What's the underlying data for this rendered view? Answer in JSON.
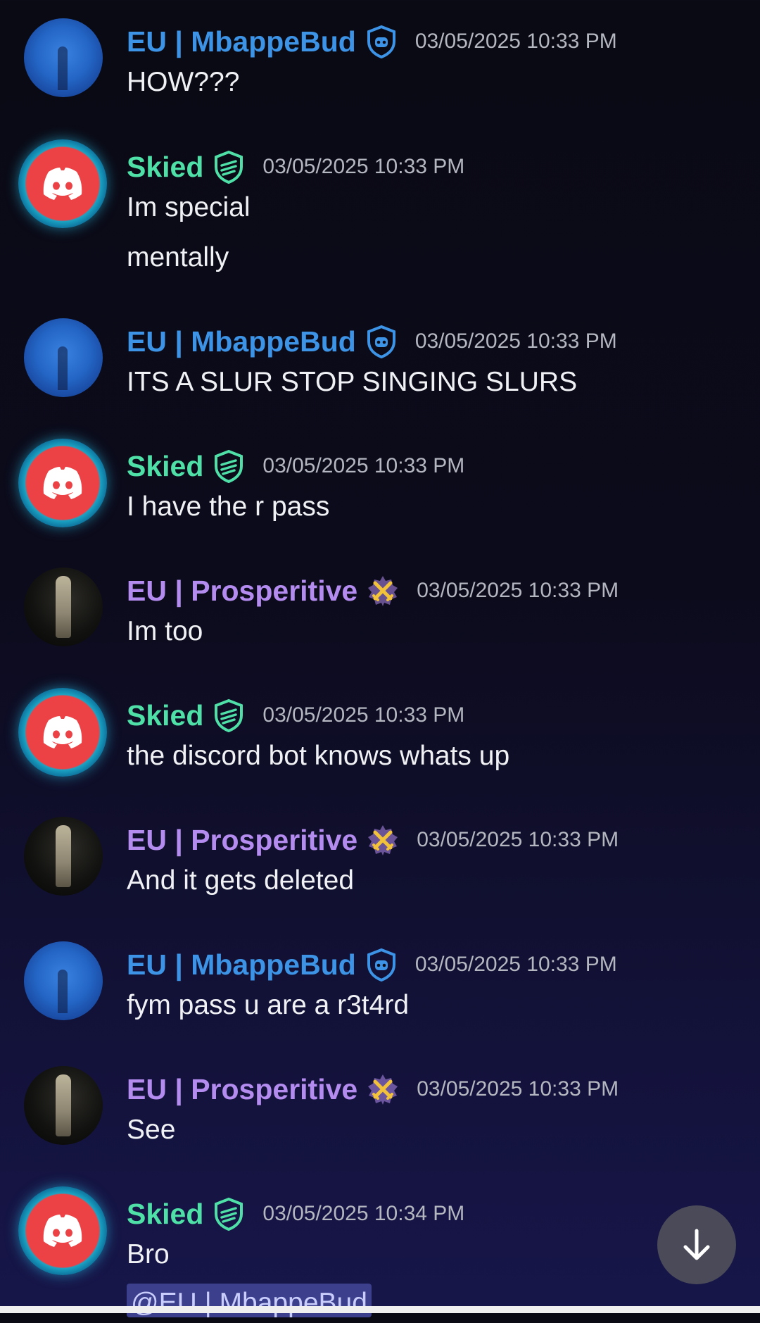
{
  "messages": [
    {
      "author": "EU | MbappeBud",
      "badge": "shield-mod-icon",
      "timestamp": "03/05/2025 10:33 PM",
      "lines": [
        "HOW???"
      ]
    },
    {
      "author": "Skied",
      "badge": "verified-shield-icon",
      "timestamp": "03/05/2025 10:33 PM",
      "lines": [
        "Im special",
        "mentally"
      ]
    },
    {
      "author": "EU | MbappeBud",
      "badge": "shield-mod-icon",
      "timestamp": "03/05/2025 10:33 PM",
      "lines": [
        "ITS A SLUR STOP SINGING SLURS"
      ]
    },
    {
      "author": "Skied",
      "badge": "verified-shield-icon",
      "timestamp": "03/05/2025 10:33 PM",
      "lines": [
        "I have the r pass"
      ]
    },
    {
      "author": "EU | Prosperitive",
      "badge": "crossed-swords-icon",
      "timestamp": "03/05/2025 10:33 PM",
      "lines": [
        "Im too"
      ]
    },
    {
      "author": "Skied",
      "badge": "verified-shield-icon",
      "timestamp": "03/05/2025 10:33 PM",
      "lines": [
        "the discord bot knows whats up"
      ]
    },
    {
      "author": "EU | Prosperitive",
      "badge": "crossed-swords-icon",
      "timestamp": "03/05/2025 10:33 PM",
      "lines": [
        "And it gets deleted"
      ]
    },
    {
      "author": "EU | MbappeBud",
      "badge": "shield-mod-icon",
      "timestamp": "03/05/2025 10:33 PM",
      "lines": [
        "fym pass u are a r3t4rd"
      ]
    },
    {
      "author": "EU | Prosperitive",
      "badge": "crossed-swords-icon",
      "timestamp": "03/05/2025 10:33 PM",
      "lines": [
        "See"
      ]
    },
    {
      "author": "Skied",
      "badge": "verified-shield-icon",
      "timestamp": "03/05/2025 10:34 PM",
      "lines": [
        "Bro"
      ],
      "mention": "@EU | MbappeBud"
    }
  ],
  "colors": {
    "mbappe": "#3d94e6",
    "skied": "#4fe0a8",
    "prosperitive": "#b48cf0"
  },
  "scroll_button": {
    "icon": "arrow-down-icon"
  }
}
